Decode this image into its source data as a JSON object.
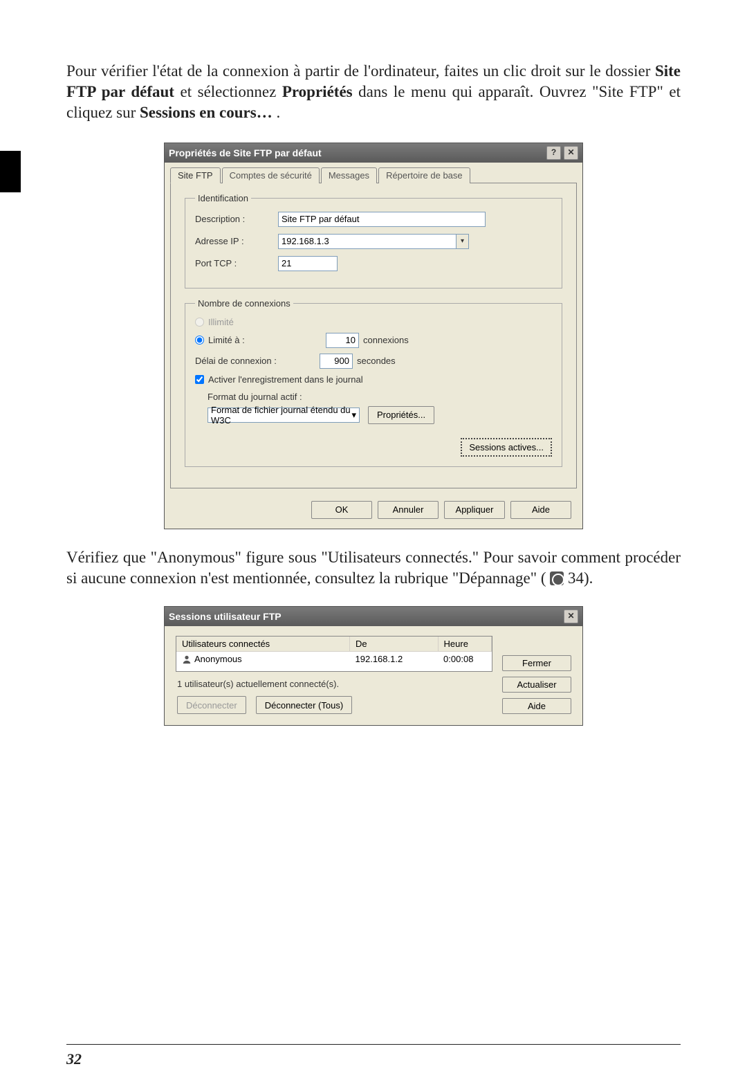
{
  "para1": {
    "t1": "Pour vérifier l'état de la connexion à partir de l'ordinateur, faites un clic droit sur le dossier ",
    "b1": "Site FTP par défaut",
    "t2": " et sélectionnez ",
    "b2": "Propriétés",
    "t3": " dans le menu qui apparaît. Ouvrez \"Site FTP\" et cliquez sur ",
    "b3": "Sessions en cours…",
    "t4": "."
  },
  "para2": {
    "t1": "Vérifiez que \"Anonymous\" figure sous \"Utilisateurs connectés.\"  Pour savoir comment procéder si aucune connexion n'est mentionnée, consultez la rubrique \"Dépannage\" (",
    "t2": " 34)."
  },
  "page_number": "32",
  "props_dialog": {
    "title": "Propriétés de Site FTP par défaut",
    "tabs": [
      "Site FTP",
      "Comptes de sécurité",
      "Messages",
      "Répertoire de base"
    ],
    "ident_legend": "Identification",
    "desc_label": "Description :",
    "desc_value": "Site FTP par défaut",
    "ip_label": "Adresse IP :",
    "ip_value": "192.168.1.3",
    "port_label": "Port TCP :",
    "port_value": "21",
    "conn_legend": "Nombre de connexions",
    "radio_unlimited": "Illimité",
    "radio_limited": "Limité à :",
    "limited_value": "10",
    "limited_unit": "connexions",
    "timeout_label": "Délai de connexion :",
    "timeout_value": "900",
    "timeout_unit": "secondes",
    "log_cb": "Activer l'enregistrement dans le journal",
    "log_format_label": "Format du journal actif :",
    "log_format_value": "Format de fichier journal étendu du W3C",
    "log_props_btn": "Propriétés...",
    "sessions_btn": "Sessions actives...",
    "ok": "OK",
    "cancel": "Annuler",
    "apply": "Appliquer",
    "help": "Aide"
  },
  "sessions_dialog": {
    "title": "Sessions utilisateur FTP",
    "col_user": "Utilisateurs connectés",
    "col_from": "De",
    "col_time": "Heure",
    "row_user": "Anonymous",
    "row_from": "192.168.1.2",
    "row_time": "0:00:08",
    "close": "Fermer",
    "refresh": "Actualiser",
    "help": "Aide",
    "status": "1 utilisateur(s) actuellement connecté(s).",
    "disconnect": "Déconnecter",
    "disconnect_all": "Déconnecter (Tous)"
  }
}
